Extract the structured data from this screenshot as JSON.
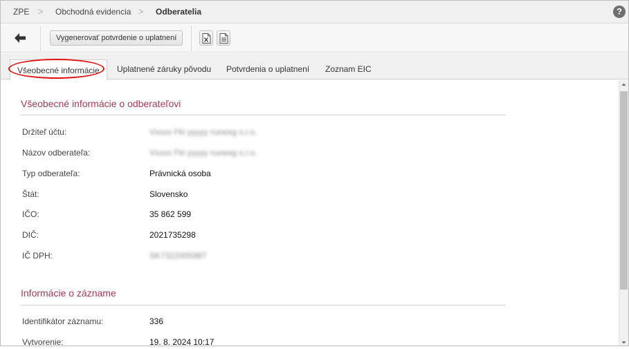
{
  "breadcrumb": {
    "items": [
      "ZPE",
      "Obchodná evidencia",
      "Odberatelia"
    ],
    "separator": ">"
  },
  "help": {
    "label": "?"
  },
  "toolbar": {
    "generate_label": "Vygenerovať potvrdenie o uplatnení"
  },
  "tabs": [
    {
      "label": "Všeobecné informácie",
      "active": true
    },
    {
      "label": "Uplatnené záruky pôvodu",
      "active": false
    },
    {
      "label": "Potvrdenia o uplatnení",
      "active": false
    },
    {
      "label": "Zoznam EIC",
      "active": false
    }
  ],
  "general": {
    "title": "Všeobecné informácie o odberateľovi",
    "rows": [
      {
        "label": "Držiteľ účtu:",
        "value": "Vxxxx Fkl yyyyy ruvwxg s.r.o.",
        "blurred": true
      },
      {
        "label": "Názov odberateľa:",
        "value": "Vxxxx Fkl yyyyy ruvwxg s.r.o.",
        "blurred": true
      },
      {
        "label": "Typ odberateľa:",
        "value": "Právnická osoba",
        "blurred": false
      },
      {
        "label": "Štát:",
        "value": "Slovensko",
        "blurred": false
      },
      {
        "label": "IČO:",
        "value": "35 862 599",
        "blurred": false
      },
      {
        "label": "DIČ:",
        "value": "2021735298",
        "blurred": false
      },
      {
        "label": "IČ DPH:",
        "value": "SK7322005987",
        "blurred": true
      }
    ]
  },
  "record": {
    "title": "Informácie o zázname",
    "rows": [
      {
        "label": "Identifikátor záznamu:",
        "value": "336"
      },
      {
        "label": "Vytvorenie:",
        "value": "19. 8. 2024 10:17"
      }
    ]
  },
  "colors": {
    "section_title": "#a33a55",
    "highlight_oval": "#e01010"
  }
}
